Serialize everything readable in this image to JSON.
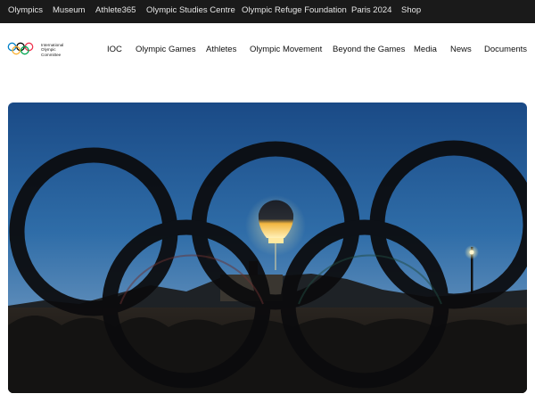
{
  "topbar": {
    "links": [
      "Olympics",
      "Museum",
      "Athlete365",
      "Olympic Studies Centre",
      "Olympic Refuge Foundation",
      "Paris 2024",
      "Shop"
    ]
  },
  "header": {
    "logo_lines": [
      "International",
      "Olympic",
      "Committee"
    ],
    "nav": [
      "IOC",
      "Olympic Games",
      "Athletes",
      "Olympic Movement",
      "Beyond the Games",
      "Media",
      "News",
      "Documents"
    ]
  },
  "hero": {
    "icon": "olympic-cauldron-balloon-photo"
  }
}
